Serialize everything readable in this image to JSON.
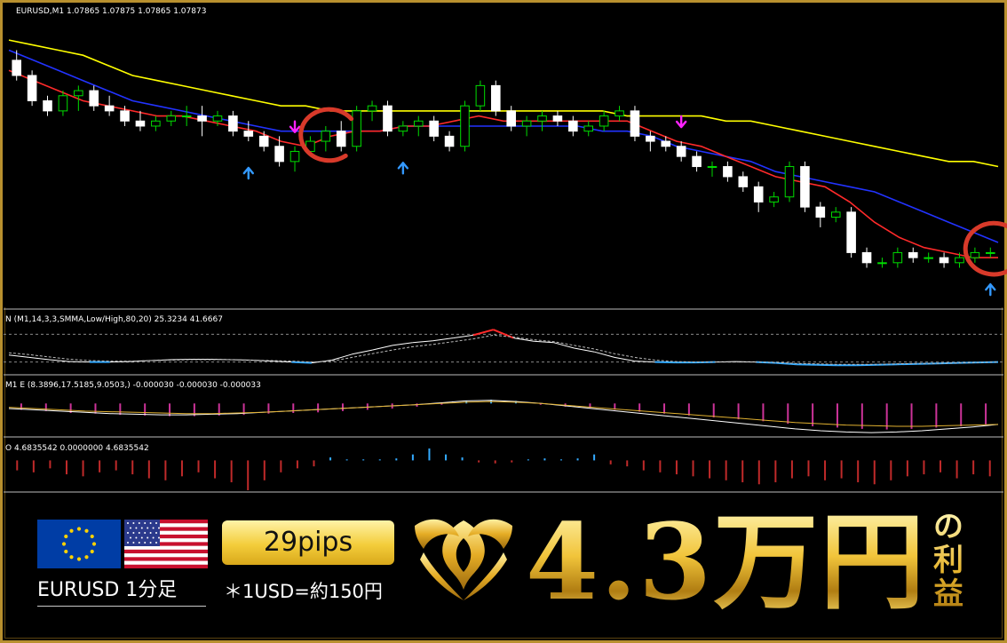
{
  "chart_data": [
    {
      "type": "candlestick",
      "title": "EURUSD,M1  1.07865 1.07875 1.07865 1.07873",
      "symbol": "EURUSD",
      "timeframe": "M1",
      "ohlc_header": [
        1.07865,
        1.07875,
        1.07865,
        1.07873
      ],
      "price_scale": "price units (approx., scale not printed)",
      "candles": [
        [
          1.0801,
          1.0803,
          1.0797,
          1.0798
        ],
        [
          1.0798,
          1.0799,
          1.0792,
          1.0793
        ],
        [
          1.0793,
          1.0794,
          1.079,
          1.0791
        ],
        [
          1.0791,
          1.0795,
          1.079,
          1.0794
        ],
        [
          1.0794,
          1.0796,
          1.0791,
          1.0795
        ],
        [
          1.0795,
          1.0796,
          1.0791,
          1.0792
        ],
        [
          1.0792,
          1.0794,
          1.079,
          1.0791
        ],
        [
          1.0791,
          1.0792,
          1.0788,
          1.0789
        ],
        [
          1.0789,
          1.0791,
          1.0787,
          1.0788
        ],
        [
          1.0788,
          1.079,
          1.0787,
          1.0789
        ],
        [
          1.0789,
          1.0791,
          1.0788,
          1.079
        ],
        [
          1.079,
          1.0792,
          1.0788,
          1.079
        ],
        [
          1.079,
          1.0792,
          1.0786,
          1.0789
        ],
        [
          1.0789,
          1.0791,
          1.0788,
          1.079
        ],
        [
          1.079,
          1.0791,
          1.0786,
          1.0787
        ],
        [
          1.0787,
          1.0789,
          1.0785,
          1.0786
        ],
        [
          1.0786,
          1.0787,
          1.0783,
          1.0784
        ],
        [
          1.0784,
          1.0786,
          1.078,
          1.0781
        ],
        [
          1.0781,
          1.0784,
          1.0779,
          1.0783
        ],
        [
          1.0783,
          1.0786,
          1.0782,
          1.0785
        ],
        [
          1.0785,
          1.0788,
          1.0783,
          1.0787
        ],
        [
          1.0787,
          1.0789,
          1.0783,
          1.0784
        ],
        [
          1.0784,
          1.0792,
          1.0783,
          1.0791
        ],
        [
          1.0791,
          1.0793,
          1.0789,
          1.0792
        ],
        [
          1.0792,
          1.0793,
          1.0786,
          1.0787
        ],
        [
          1.0787,
          1.0789,
          1.0786,
          1.0788
        ],
        [
          1.0788,
          1.079,
          1.0786,
          1.0789
        ],
        [
          1.0789,
          1.079,
          1.0785,
          1.0786
        ],
        [
          1.0786,
          1.0787,
          1.0783,
          1.0784
        ],
        [
          1.0784,
          1.0793,
          1.0783,
          1.0792
        ],
        [
          1.0792,
          1.0797,
          1.0791,
          1.0796
        ],
        [
          1.0796,
          1.0797,
          1.079,
          1.0791
        ],
        [
          1.0791,
          1.0792,
          1.0787,
          1.0788
        ],
        [
          1.0788,
          1.079,
          1.0786,
          1.0789
        ],
        [
          1.0789,
          1.0791,
          1.0787,
          1.079
        ],
        [
          1.079,
          1.0791,
          1.0788,
          1.0789
        ],
        [
          1.0789,
          1.079,
          1.0786,
          1.0787
        ],
        [
          1.0787,
          1.0789,
          1.0786,
          1.0788
        ],
        [
          1.0788,
          1.0791,
          1.0787,
          1.079
        ],
        [
          1.079,
          1.0792,
          1.0789,
          1.0791
        ],
        [
          1.0791,
          1.0792,
          1.0785,
          1.0786
        ],
        [
          1.0786,
          1.0787,
          1.0783,
          1.0785
        ],
        [
          1.0785,
          1.0786,
          1.0783,
          1.0784
        ],
        [
          1.0784,
          1.0785,
          1.0781,
          1.0782
        ],
        [
          1.0782,
          1.0783,
          1.0779,
          1.078
        ],
        [
          1.078,
          1.0781,
          1.0778,
          1.078
        ],
        [
          1.078,
          1.0781,
          1.0777,
          1.0778
        ],
        [
          1.0778,
          1.0779,
          1.0775,
          1.0776
        ],
        [
          1.0776,
          1.0777,
          1.0771,
          1.0773
        ],
        [
          1.0773,
          1.0775,
          1.0772,
          1.0774
        ],
        [
          1.0774,
          1.0781,
          1.0773,
          1.078
        ],
        [
          1.078,
          1.0781,
          1.0771,
          1.0772
        ],
        [
          1.0772,
          1.0773,
          1.0768,
          1.077
        ],
        [
          1.077,
          1.0772,
          1.0769,
          1.0771
        ],
        [
          1.0771,
          1.0772,
          1.0762,
          1.0763
        ],
        [
          1.0763,
          1.0764,
          1.076,
          1.0761
        ],
        [
          1.0761,
          1.0762,
          1.076,
          1.0761
        ],
        [
          1.0761,
          1.0764,
          1.076,
          1.0763
        ],
        [
          1.0763,
          1.0764,
          1.0761,
          1.0762
        ],
        [
          1.0762,
          1.0763,
          1.0761,
          1.0762
        ],
        [
          1.0762,
          1.0763,
          1.076,
          1.0761
        ],
        [
          1.0761,
          1.0763,
          1.076,
          1.0762
        ],
        [
          1.0762,
          1.0764,
          1.0761,
          1.0763
        ],
        [
          1.0763,
          1.0764,
          1.0762,
          1.0763
        ]
      ],
      "moving_averages": [
        {
          "color": "#ffff00",
          "values": [
            1.0805,
            1.0804,
            1.0803,
            1.0802,
            1.08,
            1.0798,
            1.0797,
            1.0796,
            1.0795,
            1.0794,
            1.0793,
            1.0792,
            1.0792,
            1.0791,
            1.0791,
            1.0791,
            1.0791,
            1.0791,
            1.0791,
            1.0791,
            1.0791,
            1.0791,
            1.0791,
            1.0791,
            1.0791,
            1.079,
            1.079,
            1.079,
            1.079,
            1.0789,
            1.0789,
            1.0788,
            1.0787,
            1.0786,
            1.0785,
            1.0784,
            1.0783,
            1.0782,
            1.0781,
            1.0781,
            1.078
          ]
        },
        {
          "color": "#2233ff",
          "values": [
            1.0803,
            1.0801,
            1.0799,
            1.0797,
            1.0795,
            1.0793,
            1.0792,
            1.0791,
            1.079,
            1.0789,
            1.0788,
            1.0787,
            1.0787,
            1.0787,
            1.0787,
            1.0787,
            1.0788,
            1.0788,
            1.0788,
            1.0788,
            1.0788,
            1.0788,
            1.0788,
            1.0788,
            1.0787,
            1.0787,
            1.0786,
            1.0784,
            1.0783,
            1.0782,
            1.0781,
            1.0779,
            1.0778,
            1.0777,
            1.0776,
            1.0775,
            1.0773,
            1.0771,
            1.0769,
            1.0767,
            1.0765
          ]
        },
        {
          "color": "#ff2a2a",
          "values": [
            1.0799,
            1.0797,
            1.0795,
            1.0793,
            1.0792,
            1.0791,
            1.079,
            1.079,
            1.0789,
            1.0788,
            1.0787,
            1.0785,
            1.0784,
            1.0786,
            1.0787,
            1.0787,
            1.0788,
            1.0788,
            1.0789,
            1.079,
            1.0789,
            1.0789,
            1.0789,
            1.0789,
            1.0789,
            1.0789,
            1.0787,
            1.0785,
            1.0784,
            1.0782,
            1.078,
            1.0778,
            1.0777,
            1.0776,
            1.0773,
            1.0769,
            1.0766,
            1.0764,
            1.0763,
            1.0762,
            1.0762
          ]
        }
      ],
      "signals": [
        {
          "type": "sell",
          "color": "#ff22ff",
          "candle": 18
        },
        {
          "type": "buy",
          "color": "#3399ff",
          "candle": 15
        },
        {
          "type": "buy",
          "color": "#3399ff",
          "candle": 25
        },
        {
          "type": "sell",
          "color": "#ff22ff",
          "candle": 43
        },
        {
          "type": "buy",
          "color": "#3399ff",
          "candle": 66
        }
      ],
      "highlights": [
        {
          "candle": 20,
          "color": "#d83a2a"
        },
        {
          "candle": 70,
          "color": "#d83a2a"
        }
      ],
      "grid": false
    },
    {
      "type": "line",
      "title": "N (M1,14,3,3,SMMA,Low/High,80,20) 25.3234 41.6667",
      "ylim": [
        0,
        100
      ],
      "levels": [
        80,
        20
      ],
      "series": [
        {
          "color": "#ffffff",
          "values": [
            35,
            30,
            25,
            21,
            20,
            20,
            21,
            23,
            25,
            26,
            26,
            25,
            24,
            22,
            20,
            18,
            24,
            37,
            46,
            56,
            62,
            66,
            72,
            78,
            90,
            72,
            65,
            62,
            50,
            42,
            30,
            22,
            20,
            19,
            19,
            20,
            21,
            20,
            18,
            15,
            14,
            13,
            13,
            14,
            15,
            16,
            17,
            18,
            19,
            20
          ]
        },
        {
          "color": "#bbbbbb",
          "values": [
            40,
            36,
            31,
            26,
            23,
            22,
            22,
            23,
            24,
            25,
            25,
            25,
            24,
            23,
            22,
            20,
            22,
            30,
            38,
            46,
            53,
            58,
            64,
            70,
            78,
            74,
            68,
            64,
            56,
            48,
            38,
            30,
            24,
            21,
            20,
            20,
            20,
            20,
            19,
            17,
            16,
            15,
            15,
            15,
            16,
            17,
            17,
            18,
            19,
            20
          ]
        }
      ]
    },
    {
      "type": "bar",
      "title": "M1 E (8.3896,17.5185,9.0503,) -0.000030 -0.000030 -0.000033",
      "ylim": [
        -0.0005,
        0.0002
      ],
      "values": [
        -0.0001,
        -0.00012,
        -0.00015,
        -0.00016,
        -0.00018,
        -0.00019,
        -0.0002,
        -0.0002,
        -0.00019,
        -0.00018,
        -0.00016,
        -0.00015,
        -0.00014,
        -0.00012,
        -0.0001,
        -8e-05,
        -5e-05,
        -2e-05,
        4e-05,
        6e-05,
        4e-05,
        -2e-05,
        -5e-05,
        -7e-05,
        -0.0001,
        -0.00013,
        -0.00016,
        -0.00019,
        -0.00022,
        -0.00025,
        -0.00028,
        -0.00032,
        -0.00036,
        -0.00038,
        -0.0004,
        -0.00041,
        -0.0004,
        -0.00038,
        -0.00036,
        -0.00033
      ],
      "series": [
        {
          "color": "#ffffff",
          "values": [
            -8e-05,
            -0.0001,
            -0.00012,
            -0.00014,
            -0.00016,
            -0.00017,
            -0.00018,
            -0.00018,
            -0.00017,
            -0.00016,
            -0.00014,
            -0.00012,
            -0.0001,
            -8e-05,
            -6e-05,
            -4e-05,
            -2e-05,
            1e-05,
            4e-05,
            5e-05,
            3e-05,
            0.0,
            -4e-05,
            -8e-05,
            -0.00012,
            -0.00016,
            -0.0002,
            -0.00024,
            -0.00028,
            -0.00032,
            -0.00036,
            -0.0004,
            -0.00043,
            -0.00045,
            -0.00046,
            -0.00045,
            -0.00043,
            -0.0004,
            -0.00037,
            -0.00033
          ]
        },
        {
          "color": "#e0b030",
          "values": [
            -6e-05,
            -8e-05,
            -0.0001,
            -0.00012,
            -0.00013,
            -0.00014,
            -0.00015,
            -0.00016,
            -0.00016,
            -0.00015,
            -0.00014,
            -0.00012,
            -0.0001,
            -8e-05,
            -6e-05,
            -4e-05,
            -2e-05,
            0.0,
            2e-05,
            3e-05,
            2e-05,
            0.0,
            -3e-05,
            -6e-05,
            -9e-05,
            -0.00012,
            -0.00015,
            -0.00018,
            -0.00021,
            -0.00024,
            -0.00027,
            -0.0003,
            -0.00032,
            -0.00034,
            -0.00035,
            -0.00036,
            -0.00036,
            -0.00035,
            -0.00034,
            -0.00033
          ]
        }
      ]
    },
    {
      "type": "bar",
      "title": "O 4.6835542 0.0000000 4.6835542",
      "ylim": [
        -30,
        20
      ],
      "values": [
        -10,
        -12,
        -8,
        -14,
        -16,
        -12,
        -10,
        -14,
        -18,
        -20,
        -16,
        -12,
        -18,
        -22,
        -30,
        -20,
        -12,
        -8,
        -6,
        3,
        1,
        1,
        1,
        2,
        6,
        12,
        6,
        3,
        -2,
        -3,
        -2,
        1,
        2,
        1,
        2,
        6,
        -4,
        -6,
        -10,
        -12,
        -14,
        -16,
        -18,
        -20,
        -22,
        -24,
        -22,
        -18,
        -16,
        -20,
        -18,
        -22,
        -24,
        -20,
        -16,
        -14,
        -12,
        -18,
        -14,
        -16
      ]
    }
  ],
  "banner": {
    "pair_label": "EURUSD 1分足",
    "pips_label": "29pips",
    "rate_note": "＊1USD=約150円",
    "amount": "4.3万円",
    "suffix_1": "の",
    "suffix_2": "利",
    "suffix_3": "益"
  },
  "colors": {
    "gold": "#d4a42a",
    "background": "#000000",
    "bull": "#00dd00",
    "bear": "#ffffff",
    "buy_arrow": "#3399ff",
    "sell_arrow": "#ff22ff"
  }
}
